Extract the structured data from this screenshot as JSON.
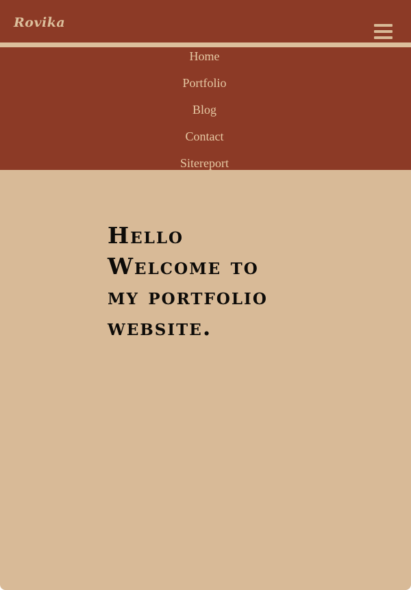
{
  "header": {
    "logo_text": "Rovika",
    "menu_icon": "hamburger-menu-icon"
  },
  "nav": {
    "items": [
      {
        "label": "Home"
      },
      {
        "label": "Portfolio"
      },
      {
        "label": "Blog"
      },
      {
        "label": "Contact"
      },
      {
        "label": "Sitereport"
      }
    ]
  },
  "hero": {
    "lines": [
      "Hello",
      "Welcome to",
      "my portfolio",
      "website."
    ]
  },
  "colors": {
    "header_bg": "#8c3a26",
    "page_bg": "#d8ba97",
    "nav_text": "#e6c9a4",
    "heading_text": "#0d0b08"
  }
}
